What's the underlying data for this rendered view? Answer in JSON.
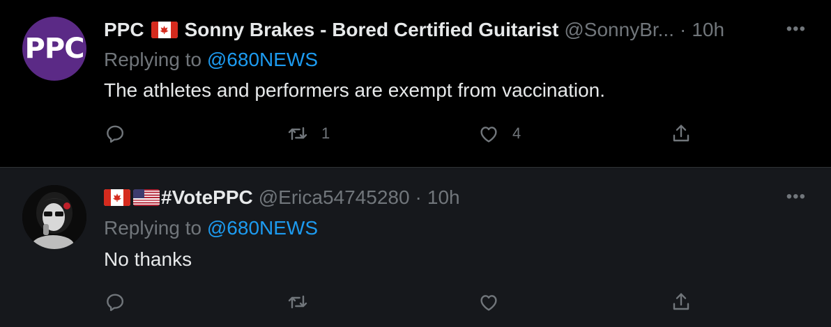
{
  "tweets": [
    {
      "avatar_text": "PPC",
      "display_name_prefix": "PPC",
      "display_name_suffix": "Sonny Brakes - Bored Certified Guitarist",
      "handle": "@SonnyBr...",
      "time_sep": "·",
      "time": "10h",
      "more": "•••",
      "replying_to_label": "Replying to",
      "replying_to_mention": "@680NEWS",
      "text": "The athletes and performers are exempt from vaccination.",
      "retweets": "1",
      "likes": "4",
      "icons": [
        "reply-icon",
        "retweet-icon",
        "like-icon",
        "share-icon"
      ]
    },
    {
      "display_name": "#VotePPC",
      "handle": "@Erica54745280",
      "time_sep": "·",
      "time": "10h",
      "more": "•••",
      "replying_to_label": "Replying to",
      "replying_to_mention": "@680NEWS",
      "text": "No thanks",
      "icons": [
        "reply-icon",
        "retweet-icon",
        "like-icon",
        "share-icon"
      ]
    }
  ],
  "colors": {
    "background": "#000000",
    "highlight_background": "#16181c",
    "text": "#e7e9ea",
    "muted": "#71767b",
    "accent": "#1d9bf0",
    "divider": "#2f3336",
    "ppc_purple": "#5b2a86"
  }
}
